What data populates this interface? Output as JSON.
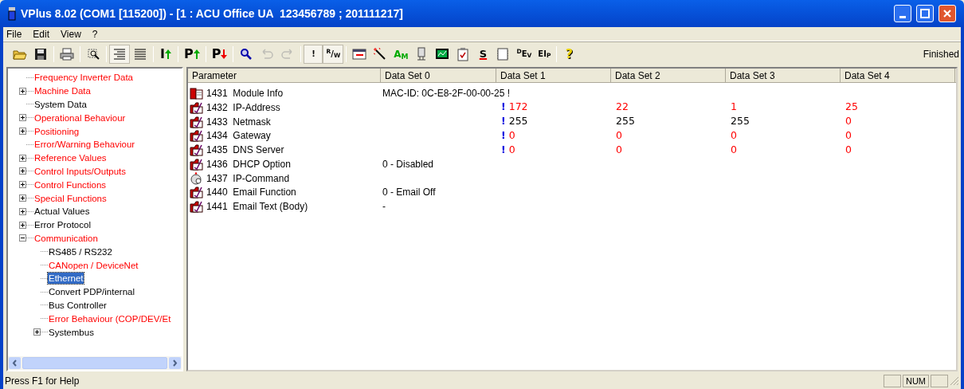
{
  "window": {
    "title": "VPlus 8.02 (COM1 [115200]) - [1 : ACU Office UA  123456789 ; 201111217]"
  },
  "menu": [
    "File",
    "Edit",
    "View",
    "?"
  ],
  "toolbar": [
    {
      "kind": "open",
      "pressed": false,
      "disabled": false
    },
    {
      "kind": "save",
      "pressed": false,
      "disabled": false
    },
    {
      "kind": "separator"
    },
    {
      "kind": "print",
      "pressed": false,
      "disabled": false
    },
    {
      "kind": "separator"
    },
    {
      "kind": "select",
      "pressed": false,
      "disabled": false
    },
    {
      "kind": "separator"
    },
    {
      "kind": "tree-view",
      "pressed": true,
      "disabled": false
    },
    {
      "kind": "list-view",
      "pressed": false,
      "disabled": false
    },
    {
      "kind": "separator"
    },
    {
      "kind": "letter-up",
      "label": "I",
      "pressed": false,
      "disabled": false
    },
    {
      "kind": "separator"
    },
    {
      "kind": "letter-up",
      "label": "P",
      "pressed": false,
      "disabled": false
    },
    {
      "kind": "separator"
    },
    {
      "kind": "letter-down",
      "label": "P",
      "pressed": false,
      "disabled": false
    },
    {
      "kind": "separator"
    },
    {
      "kind": "search",
      "pressed": false,
      "disabled": false
    },
    {
      "kind": "undo",
      "pressed": false,
      "disabled": true
    },
    {
      "kind": "redo",
      "pressed": false,
      "disabled": true
    },
    {
      "kind": "separator"
    },
    {
      "kind": "letter",
      "label": "!",
      "pressed": true,
      "disabled": false
    },
    {
      "kind": "letter",
      "label": "$^{R}$/$_{W}$",
      "pressed": true,
      "disabled": false
    },
    {
      "kind": "separator"
    },
    {
      "kind": "window",
      "pressed": false,
      "disabled": false
    },
    {
      "kind": "wand",
      "pressed": false,
      "disabled": false
    },
    {
      "kind": "letter-green",
      "label": "A$_{M}$",
      "pressed": false,
      "disabled": false
    },
    {
      "kind": "device",
      "pressed": false,
      "disabled": false
    },
    {
      "kind": "monitor",
      "pressed": false,
      "disabled": false
    },
    {
      "kind": "clipboard",
      "pressed": false,
      "disabled": false
    },
    {
      "kind": "letter-striped",
      "label": "S",
      "pressed": false,
      "disabled": false
    },
    {
      "kind": "frame",
      "pressed": false,
      "disabled": false
    },
    {
      "kind": "letter",
      "label": "$^{D}$E$_{V}$",
      "pressed": false,
      "disabled": false
    },
    {
      "kind": "letter",
      "label": "EI$_{P}$",
      "pressed": false,
      "disabled": false
    },
    {
      "kind": "separator"
    },
    {
      "kind": "letter-yellow",
      "label": "?",
      "pressed": false,
      "disabled": false
    }
  ],
  "toolbar_status": "Finished",
  "tree": [
    {
      "label": "Frequency Inverter Data",
      "kind": "leaf",
      "selected": false,
      "color": "#ff0000"
    },
    {
      "label": "Machine Data",
      "kind": "group",
      "expanded": false,
      "selected": false,
      "color": "#ff0000"
    },
    {
      "label": "System Data",
      "kind": "leaf",
      "selected": false,
      "color": "#000000"
    },
    {
      "label": "Operational Behaviour",
      "kind": "group",
      "expanded": false,
      "selected": false,
      "color": "#ff0000"
    },
    {
      "label": "Positioning",
      "kind": "group",
      "expanded": false,
      "selected": false,
      "color": "#ff0000"
    },
    {
      "label": "Error/Warning Behaviour",
      "kind": "leaf",
      "selected": false,
      "color": "#ff0000"
    },
    {
      "label": "Reference Values",
      "kind": "group",
      "expanded": false,
      "selected": false,
      "color": "#ff0000"
    },
    {
      "label": "Control Inputs/Outputs",
      "kind": "group",
      "expanded": false,
      "selected": false,
      "color": "#ff0000"
    },
    {
      "label": "Control Functions",
      "kind": "group",
      "expanded": false,
      "selected": false,
      "color": "#ff0000"
    },
    {
      "label": "Special Functions",
      "kind": "group",
      "expanded": false,
      "selected": false,
      "color": "#ff0000"
    },
    {
      "label": "Actual Values",
      "kind": "group",
      "expanded": false,
      "selected": false,
      "color": "#000000"
    },
    {
      "label": "Error Protocol",
      "kind": "group",
      "expanded": false,
      "selected": false,
      "color": "#000000"
    },
    {
      "label": "Communication",
      "kind": "group",
      "expanded": true,
      "selected": false,
      "color": "#ff0000",
      "children": [
        {
          "label": "RS485 / RS232",
          "kind": "leaf",
          "selected": false,
          "color": "#000000"
        },
        {
          "label": "CANopen / DeviceNet",
          "kind": "leaf",
          "selected": false,
          "color": "#ff0000"
        },
        {
          "label": "Ethernet",
          "kind": "leaf",
          "selected": true
        },
        {
          "label": "Convert PDP/internal",
          "kind": "leaf",
          "selected": false,
          "color": "#000000"
        },
        {
          "label": "Bus Controller",
          "kind": "leaf",
          "selected": false,
          "color": "#000000"
        },
        {
          "label": "Error Behaviour (COP/DEV/Et",
          "kind": "leaf",
          "selected": false,
          "color": "#ff0000"
        },
        {
          "label": "Systembus",
          "kind": "group",
          "expanded": false,
          "selected": false,
          "color": "#000000"
        }
      ]
    }
  ],
  "table": {
    "columns": [
      "Parameter",
      "Data Set 0",
      "Data Set 1",
      "Data Set 2",
      "Data Set 3",
      "Data Set 4"
    ],
    "rows": [
      {
        "kind": "info",
        "number": "1431",
        "name": "Module Info",
        "data_set_0": "MAC-ID: 0C-E8-2F-00-00-25 !"
      },
      {
        "kind": "parameter",
        "number": "1432",
        "name": "IP-Address",
        "data_sets": [
          {
            "flag": "!",
            "text": "172",
            "color": "#ff0000"
          },
          {
            "text": "22",
            "color": "#ff0000"
          },
          {
            "text": "1",
            "color": "#ff0000"
          },
          {
            "text": "25",
            "color": "#ff0000"
          }
        ]
      },
      {
        "kind": "parameter",
        "number": "1433",
        "name": "Netmask",
        "data_sets": [
          {
            "flag": "!",
            "text": "255",
            "color": "#000000"
          },
          {
            "text": "255",
            "color": "#000000"
          },
          {
            "text": "255",
            "color": "#000000"
          },
          {
            "text": "0",
            "color": "#ff0000"
          }
        ]
      },
      {
        "kind": "parameter",
        "number": "1434",
        "name": "Gateway",
        "data_sets": [
          {
            "flag": "!",
            "text": "0",
            "color": "#ff0000"
          },
          {
            "text": "0",
            "color": "#ff0000"
          },
          {
            "text": "0",
            "color": "#ff0000"
          },
          {
            "text": "0",
            "color": "#ff0000"
          }
        ]
      },
      {
        "kind": "parameter",
        "number": "1435",
        "name": "DNS Server",
        "data_sets": [
          {
            "flag": "!",
            "text": "0",
            "color": "#ff0000"
          },
          {
            "text": "0",
            "color": "#ff0000"
          },
          {
            "text": "0",
            "color": "#ff0000"
          },
          {
            "text": "0",
            "color": "#ff0000"
          }
        ]
      },
      {
        "kind": "parameter",
        "number": "1436",
        "name": "DHCP Option",
        "data_set_0": "0 - Disabled"
      },
      {
        "kind": "command",
        "number": "1437",
        "name": "IP-Command"
      },
      {
        "kind": "parameter",
        "number": "1440",
        "name": "Email Function",
        "data_set_0": "0 - Email Off"
      },
      {
        "kind": "parameter",
        "number": "1441",
        "name": "Email Text (Body)",
        "data_set_0": "-"
      }
    ]
  },
  "status_bar": {
    "text": "Press F1 for Help",
    "panels": [
      "NUM"
    ]
  }
}
